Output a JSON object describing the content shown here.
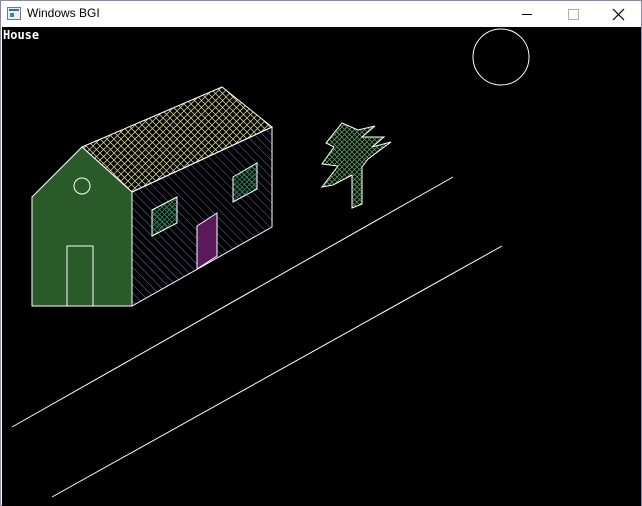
{
  "window": {
    "title": "Windows BGI",
    "controls": {
      "minimize": "minimize",
      "maximize": "maximize",
      "close": "close"
    }
  },
  "canvas": {
    "label": "House",
    "colors": {
      "background": "#000000",
      "outline": "#ffffff",
      "front_wall": "#2a5a2a",
      "roof_hatch": "#c8c890",
      "side_hatch": "#8a8ae8",
      "door": "#5a1a5a",
      "tree": "#5a9a5a"
    }
  }
}
